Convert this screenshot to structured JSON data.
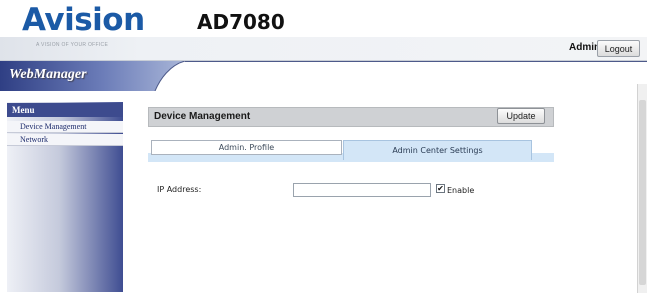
{
  "brand": {
    "logo_text": "Avision",
    "tagline": "A VISION OF YOUR OFFICE",
    "model": "AD7080",
    "logo_color": "#1b5aa6"
  },
  "header": {
    "user_label": "Admin",
    "logout_label": "Logout"
  },
  "banner": {
    "title": "WebManager"
  },
  "sidebar": {
    "menu_title": "Menu",
    "items": [
      {
        "label": "Device Management"
      },
      {
        "label": "Network"
      }
    ]
  },
  "panel": {
    "title": "Device Management",
    "update_label": "Update",
    "tabs": [
      {
        "label": "Admin. Profile",
        "active": false
      },
      {
        "label": "Admin Center Settings",
        "active": true
      }
    ],
    "active_tab_color": "#d3e6f7"
  },
  "form": {
    "ip_label": "IP Address:",
    "ip_value": "",
    "enable_checked": true,
    "enable_mark": "✔",
    "enable_label": "Enable"
  }
}
